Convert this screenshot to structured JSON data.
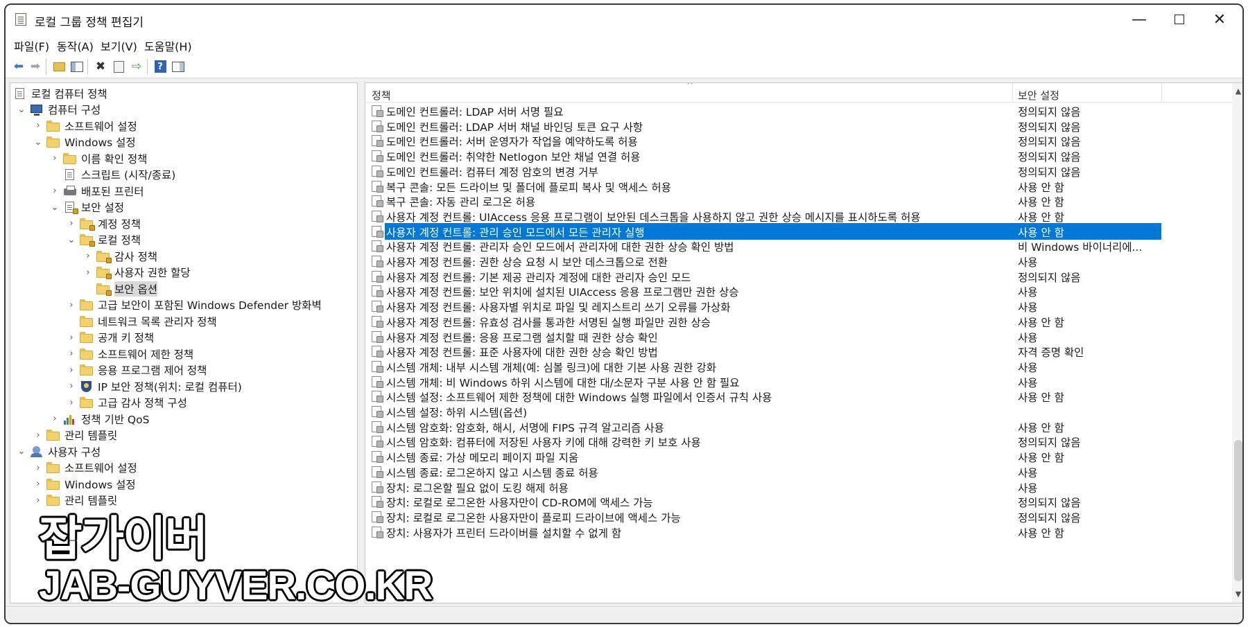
{
  "window": {
    "title": "로컬 그룹 정책 편집기",
    "minimize": "—",
    "close": "✕"
  },
  "menu": [
    "파일(F)",
    "동작(A)",
    "보기(V)",
    "도움말(H)"
  ],
  "tree": [
    {
      "label": "로컬 컴퓨터 정책",
      "chevron": "",
      "icon": "doc"
    },
    {
      "label": "컴퓨터 구성",
      "chevron": "⌄",
      "icon": "computer"
    },
    {
      "label": "소프트웨어 설정",
      "chevron": "›",
      "icon": "folder"
    },
    {
      "label": "Windows 설정",
      "chevron": "⌄",
      "icon": "folder"
    },
    {
      "label": "이름 확인 정책",
      "chevron": "›",
      "icon": "folder"
    },
    {
      "label": "스크립트 (시작/종료)",
      "chevron": "",
      "icon": "doc"
    },
    {
      "label": "배포된 프린터",
      "chevron": "›",
      "icon": "printer"
    },
    {
      "label": "보안 설정",
      "chevron": "⌄",
      "icon": "doc-lock"
    },
    {
      "label": "계정 정책",
      "chevron": "›",
      "icon": "folder-lock"
    },
    {
      "label": "로컬 정책",
      "chevron": "⌄",
      "icon": "folder-lock"
    },
    {
      "label": "감사 정책",
      "chevron": "›",
      "icon": "folder-lock"
    },
    {
      "label": "사용자 권한 할당",
      "chevron": "›",
      "icon": "folder-lock"
    },
    {
      "label": "보안 옵션",
      "chevron": "",
      "icon": "folder-lock"
    },
    {
      "label": "고급 보안이 포함된 Windows Defender 방화벽",
      "chevron": "›",
      "icon": "folder"
    },
    {
      "label": "네트워크 목록 관리자 정책",
      "chevron": "",
      "icon": "folder"
    },
    {
      "label": "공개 키 정책",
      "chevron": "›",
      "icon": "folder"
    },
    {
      "label": "소프트웨어 제한 정책",
      "chevron": "›",
      "icon": "folder"
    },
    {
      "label": "응용 프로그램 제어 정책",
      "chevron": "›",
      "icon": "folder"
    },
    {
      "label": "IP 보안 정책(위치: 로컬 컴퓨터)",
      "chevron": "›",
      "icon": "shield"
    },
    {
      "label": "고급 감사 정책 구성",
      "chevron": "›",
      "icon": "folder"
    },
    {
      "label": "정책 기반 QoS",
      "chevron": "›",
      "icon": "bars"
    },
    {
      "label": "관리 템플릿",
      "chevron": "›",
      "icon": "folder"
    },
    {
      "label": "사용자 구성",
      "chevron": "⌄",
      "icon": "user"
    },
    {
      "label": "소프트웨어 설정",
      "chevron": "›",
      "icon": "folder"
    },
    {
      "label": "Windows 설정",
      "chevron": "›",
      "icon": "folder"
    },
    {
      "label": "관리 템플릿",
      "chevron": "›",
      "icon": "folder"
    }
  ],
  "list": {
    "columns": {
      "policy": "정책",
      "setting": "보안 설정"
    },
    "sort_indicator": "^",
    "rows": [
      {
        "policy": "도메인 컨트롤러: LDAP 서버 서명 필요",
        "setting": "정의되지 않음"
      },
      {
        "policy": "도메인 컨트롤러: LDAP 서버 채널 바인딩 토큰 요구 사항",
        "setting": "정의되지 않음"
      },
      {
        "policy": "도메인 컨트롤러: 서버 운영자가 작업을 예약하도록 허용",
        "setting": "정의되지 않음"
      },
      {
        "policy": "도메인 컨트롤러: 취약한 Netlogon 보안 채널 연결 허용",
        "setting": "정의되지 않음"
      },
      {
        "policy": "도메인 컨트롤러: 컴퓨터 계정 암호의 변경 거부",
        "setting": "정의되지 않음"
      },
      {
        "policy": "복구 콘솔: 모든 드라이브 및 폴더에 플로피 복사 및 액세스 허용",
        "setting": "사용 안 함"
      },
      {
        "policy": "복구 콘솔: 자동 관리 로그온 허용",
        "setting": "사용 안 함"
      },
      {
        "policy": "사용자 계정 컨트롤: UIAccess 응용 프로그램이 보안된 데스크톱을 사용하지 않고 권한 상승 메시지를 표시하도록 허용",
        "setting": "사용 안 함"
      },
      {
        "policy": "사용자 계정 컨트롤: 관리 승인 모드에서 모든 관리자 실행",
        "setting": "사용 안 함"
      },
      {
        "policy": "사용자 계정 컨트롤: 관리자 승인 모드에서 관리자에 대한 권한 상승 확인 방법",
        "setting": "비 Windows 바이너리에..."
      },
      {
        "policy": "사용자 계정 컨트롤: 권한 상승 요청 시 보안 데스크톱으로 전환",
        "setting": "사용"
      },
      {
        "policy": "사용자 계정 컨트롤: 기본 제공 관리자 계정에 대한 관리자 승인 모드",
        "setting": "정의되지 않음"
      },
      {
        "policy": "사용자 계정 컨트롤: 보안 위치에 설치된 UIAccess 응용 프로그램만 권한 상승",
        "setting": "사용"
      },
      {
        "policy": "사용자 계정 컨트롤: 사용자별 위치로 파일 및 레지스트리 쓰기 오류를 가상화",
        "setting": "사용"
      },
      {
        "policy": "사용자 계정 컨트롤: 유효성 검사를 통과한 서명된 실행 파일만 권한 상승",
        "setting": "사용 안 함"
      },
      {
        "policy": "사용자 계정 컨트롤: 응용 프로그램 설치할 때 권한 상승 확인",
        "setting": "사용"
      },
      {
        "policy": "사용자 계정 컨트롤: 표준 사용자에 대한 권한 상승 확인 방법",
        "setting": "자격 증명 확인"
      },
      {
        "policy": "시스템 개체: 내부 시스템 개체(예: 심볼 링크)에 대한 기본 사용 권한 강화",
        "setting": "사용"
      },
      {
        "policy": "시스템 개체: 비 Windows 하위 시스템에 대한 대/소문자 구분 사용 안 함 필요",
        "setting": "사용"
      },
      {
        "policy": "시스템 설정: 소프트웨어 제한 정책에 대한 Windows 실행 파일에서 인증서 규칙 사용",
        "setting": "사용 안 함"
      },
      {
        "policy": "시스템 설정: 하위 시스템(옵션)",
        "setting": ""
      },
      {
        "policy": "시스템 암호화: 암호화, 해시, 서명에 FIPS 규격 알고리즘 사용",
        "setting": "사용 안 함"
      },
      {
        "policy": "시스템 암호화: 컴퓨터에 저장된 사용자 키에 대해 강력한 키 보호 사용",
        "setting": "정의되지 않음"
      },
      {
        "policy": "시스템 종료: 가상 메모리 페이지 파일 지움",
        "setting": "사용 안 함"
      },
      {
        "policy": "시스템 종료: 로그온하지 않고 시스템 종료 허용",
        "setting": "사용"
      },
      {
        "policy": "장치: 로그온할 필요 없이 도킹 해제 허용",
        "setting": "사용"
      },
      {
        "policy": "장치: 로컬로 로그온한 사용자만이 CD-ROM에 액세스 가능",
        "setting": "정의되지 않음"
      },
      {
        "policy": "장치: 로컬로 로그온한 사용자만이 플로피 드라이브에 액세스 가능",
        "setting": "정의되지 않음"
      },
      {
        "policy": "장치: 사용자가 프린터 드라이버를 설치할 수 없게 함",
        "setting": "사용 안 함"
      }
    ],
    "selected_index": 8
  },
  "scrollbar": {
    "up": "▲",
    "down": "▼"
  },
  "watermark": {
    "korean": "잡가이버",
    "url": "JAB-GUYVER.CO.KR"
  }
}
